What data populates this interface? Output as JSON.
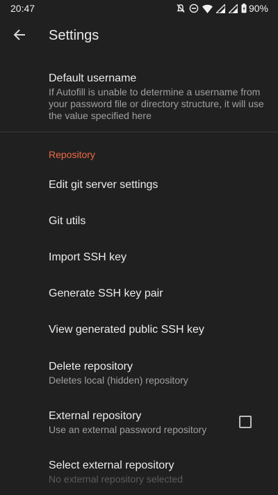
{
  "status_bar": {
    "time": "20:47",
    "battery": "90%",
    "icons": [
      "notifications-off-icon",
      "do-not-disturb-icon",
      "wifi-icon",
      "signal-icon",
      "signal-icon-2",
      "battery-icon"
    ]
  },
  "app_bar": {
    "title": "Settings",
    "back_icon": "arrow-back-icon"
  },
  "prefs_top": {
    "default_username": {
      "title": "Default username",
      "summary": "If Autofill is unable to determine a username from your password file or directory structure, it will use the value specified here"
    }
  },
  "repository": {
    "category_title": "Repository",
    "edit_git_server": {
      "title": "Edit git server settings"
    },
    "git_utils": {
      "title": "Git utils"
    },
    "import_ssh_key": {
      "title": "Import SSH key"
    },
    "generate_ssh_key": {
      "title": "Generate SSH key pair"
    },
    "view_public_key": {
      "title": "View generated public SSH key"
    },
    "delete_repository": {
      "title": "Delete repository",
      "summary": "Deletes local (hidden) repository"
    },
    "external_repository": {
      "title": "External repository",
      "summary": "Use an external password repository",
      "checked": false
    },
    "select_external_repository": {
      "title": "Select external repository",
      "summary": "No external repository selected"
    }
  },
  "colors": {
    "background": "#202020",
    "accent": "#ef6a43",
    "text_primary": "#ececec",
    "text_secondary": "#a0a0a0"
  }
}
